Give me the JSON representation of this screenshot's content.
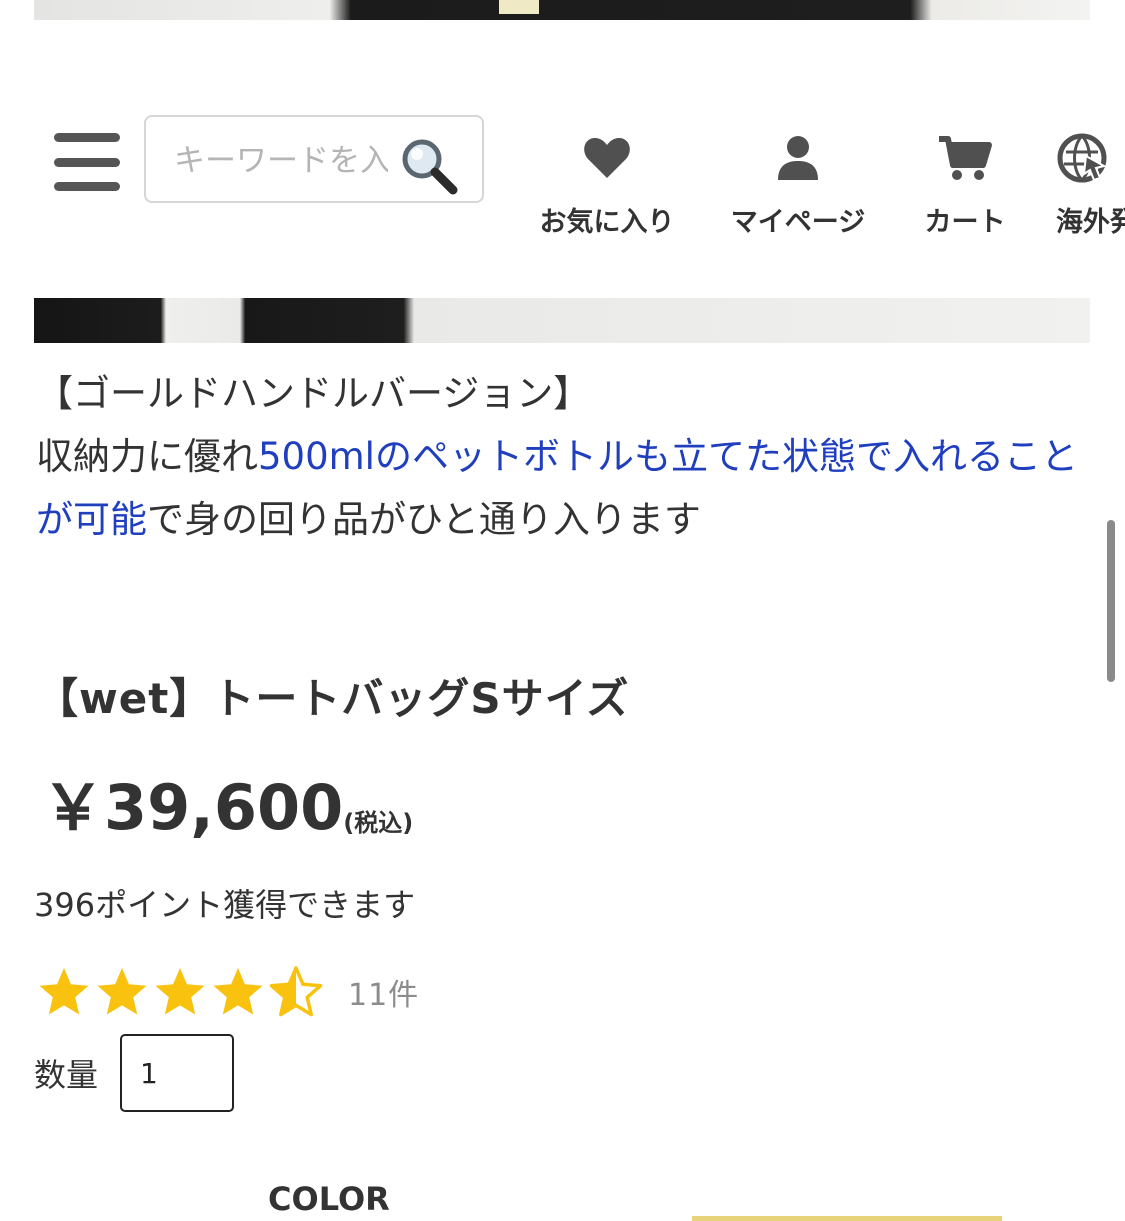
{
  "header": {
    "search": {
      "placeholder": "キーワードを入力",
      "value": ""
    },
    "nav": [
      {
        "label": "お気に入り",
        "icon": "heart-icon"
      },
      {
        "label": "マイページ",
        "icon": "user-icon"
      },
      {
        "label": "カート",
        "icon": "cart-icon"
      },
      {
        "label": "海外発送",
        "icon": "globe-icon"
      }
    ]
  },
  "description": {
    "heading": "【ゴールドハンドルバージョン】",
    "text_before": "収納力に優れ",
    "text_link": "500mlのペットボトルも立てた状態で入れることが可能",
    "text_after": "で身の回り品がひと通り入ります"
  },
  "product": {
    "title": "【wet】トートバッグSサイズ",
    "price": "￥39,600",
    "tax_note": "(税込)",
    "points": "396ポイント獲得できます",
    "rating_value": 4.5,
    "rating_max": 5,
    "review_count": "11件",
    "quantity_label": "数量",
    "quantity_value": "1",
    "color_label": "COLOR"
  },
  "colors": {
    "star": "#f9c20f",
    "link": "#1f3fbf",
    "text": "#333333"
  }
}
